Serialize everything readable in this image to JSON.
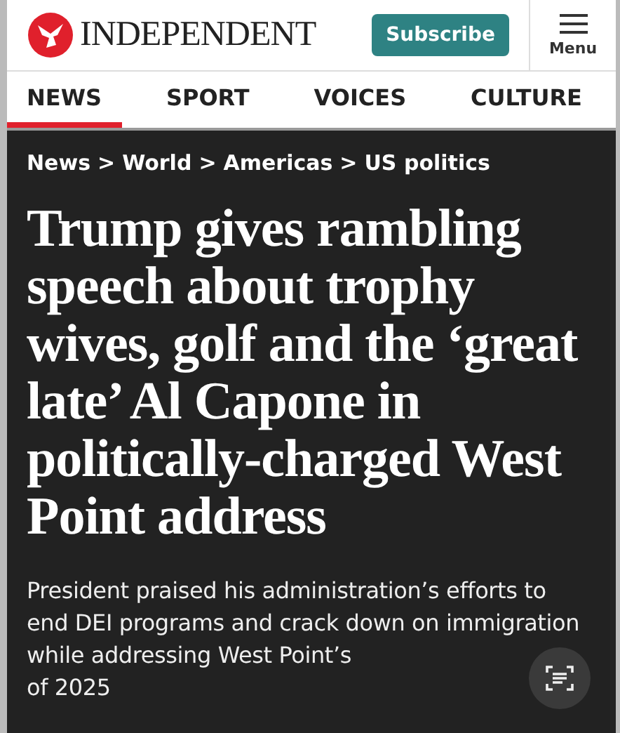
{
  "header": {
    "logo_text": "INDEPENDENT",
    "subscribe": "Subscribe",
    "menu": "Menu"
  },
  "sections": [
    {
      "label": "NEWS",
      "selected": true
    },
    {
      "label": "SPORT",
      "selected": false
    },
    {
      "label": "VOICES",
      "selected": false
    },
    {
      "label": "CULTURE",
      "selected": false
    }
  ],
  "breadcrumb": [
    "News",
    "World",
    "Americas",
    "US politics"
  ],
  "breadcrumb_separator": ">",
  "headline": "Trump gives rambling speech about trophy wives, golf and the ‘great late’ Al Capone in politically-charged West Point address",
  "summary": "President praised his administration’s efforts to end DEI programs and crack down on immigration while addressing West Point’s",
  "summary_end": "of 2025"
}
